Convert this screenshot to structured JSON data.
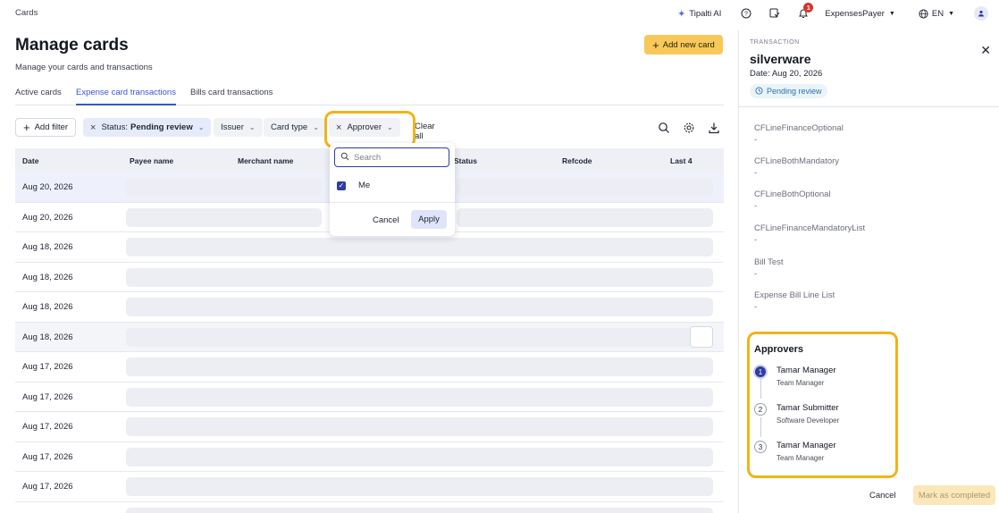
{
  "topbar": {
    "breadcrumb": "Cards",
    "ai_label": "Tipalti AI",
    "notification_count": "1",
    "account": "ExpensesPayer",
    "language": "EN"
  },
  "header": {
    "title": "Manage cards",
    "subtitle": "Manage your cards and transactions",
    "add_button": "Add new card"
  },
  "tabs": [
    {
      "label": "Active cards"
    },
    {
      "label": "Expense card transactions"
    },
    {
      "label": "Bills card transactions"
    }
  ],
  "filters": {
    "add_filter": "Add filter",
    "status_prefix": "Status:",
    "status_value": "Pending review",
    "issuer": "Issuer",
    "card_type": "Card type",
    "approver": "Approver",
    "clear_all": "Clear all"
  },
  "table": {
    "columns": [
      "Date",
      "Payee name",
      "Merchant name",
      "Status",
      "Refcode",
      "Last 4"
    ],
    "rows": [
      {
        "date": "Aug 20, 2026"
      },
      {
        "date": "Aug 20, 2026"
      },
      {
        "date": "Aug 18, 2026"
      },
      {
        "date": "Aug 18, 2026"
      },
      {
        "date": "Aug 18, 2026"
      },
      {
        "date": "Aug 18, 2026"
      },
      {
        "date": "Aug 17, 2026"
      },
      {
        "date": "Aug 17, 2026"
      },
      {
        "date": "Aug 17, 2026"
      },
      {
        "date": "Aug 17, 2026"
      },
      {
        "date": "Aug 17, 2026"
      }
    ]
  },
  "approver_dropdown": {
    "search_placeholder": "Search",
    "option": "Me",
    "option_checked": true,
    "cancel": "Cancel",
    "apply": "Apply"
  },
  "panel": {
    "kicker": "TRANSACTION",
    "title": "silverware",
    "date": "Date: Aug 20, 2026",
    "status": "Pending review",
    "fields": [
      {
        "label": "CFLineFinanceOptional",
        "value": "-"
      },
      {
        "label": "CFLineBothMandatory",
        "value": "-"
      },
      {
        "label": "CFLineBothOptional",
        "value": "-"
      },
      {
        "label": "CFLineFinanceMandatoryList",
        "value": "-"
      },
      {
        "label": "Bill Test",
        "value": "-"
      },
      {
        "label": "Expense Bill Line List",
        "value": "-"
      }
    ],
    "approvers_title": "Approvers",
    "approvers": [
      {
        "step": "1",
        "name": "Tamar Manager",
        "role": "Team Manager"
      },
      {
        "step": "2",
        "name": "Tamar Submitter",
        "role": "Software Developer"
      },
      {
        "step": "3",
        "name": "Tamar Manager",
        "role": "Team Manager"
      }
    ],
    "cancel": "Cancel",
    "complete": "Mark as completed"
  },
  "colors": {
    "accent": "#3a55d4",
    "primary_button": "#f8c95a",
    "highlight": "#f0b41a",
    "checkbox": "#2f3d9c"
  }
}
